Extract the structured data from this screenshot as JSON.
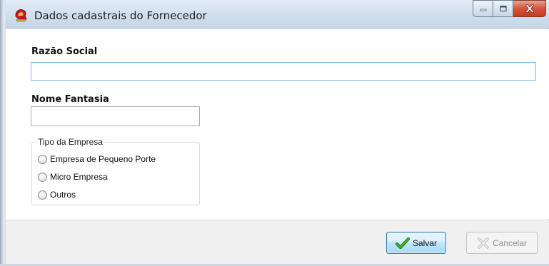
{
  "window": {
    "title": "Dados cadastrais do Fornecedor",
    "icon": "app-helmet-icon",
    "controls": [
      "minimize-icon",
      "maximize-icon",
      "close-icon"
    ]
  },
  "form": {
    "razao_social": {
      "label": "Razão Social",
      "value": "",
      "placeholder": ""
    },
    "nome_fantasia": {
      "label": "Nome Fantasia",
      "value": "",
      "placeholder": ""
    },
    "tipo_empresa": {
      "label": "Tipo da Empresa",
      "options": [
        "Empresa de Pequeno Porte",
        "Micro Empresa",
        "Outros"
      ]
    }
  },
  "buttons": {
    "save": {
      "label": "Salvar",
      "icon": "checkmark-icon",
      "color": "#2e9e1f"
    },
    "cancel": {
      "label": "Cancelar",
      "icon": "x-icon",
      "enabled": false
    }
  },
  "colors": {
    "title_bar": "#d3e1ef",
    "close_button": "#c33c22",
    "focus_border": "#7eb4ea",
    "footer": "#f0f0f0"
  }
}
